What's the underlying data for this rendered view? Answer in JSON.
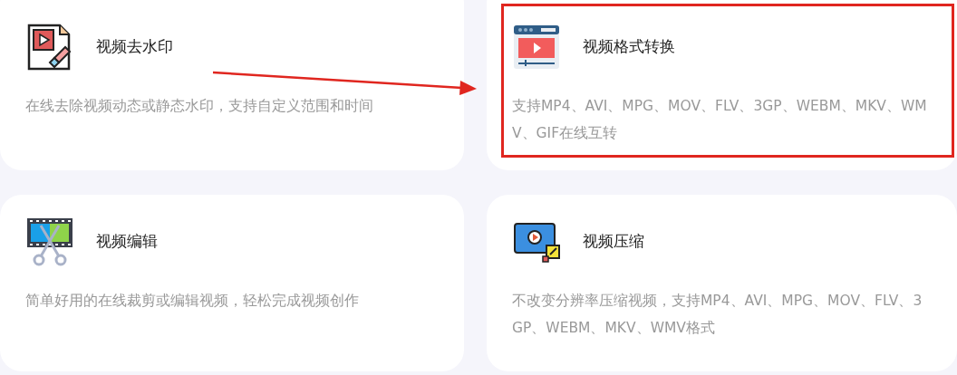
{
  "cards": [
    {
      "title": "视频去水印",
      "description": "在线去除视频动态或静态水印，支持自定义范围和时间",
      "highlighted": false
    },
    {
      "title": "视频格式转换",
      "description": "支持MP4、AVI、MPG、MOV、FLV、3GP、WEBM、MKV、WMV、GIF在线互转",
      "highlighted": true
    },
    {
      "title": "视频编辑",
      "description": "简单好用的在线裁剪或编辑视频，轻松完成视频创作",
      "highlighted": false
    },
    {
      "title": "视频压缩",
      "description": "不改变分辨率压缩视频，支持MP4、AVI、MPG、MOV、FLV、3GP、WEBM、MKV、WMV格式",
      "highlighted": false
    }
  ]
}
